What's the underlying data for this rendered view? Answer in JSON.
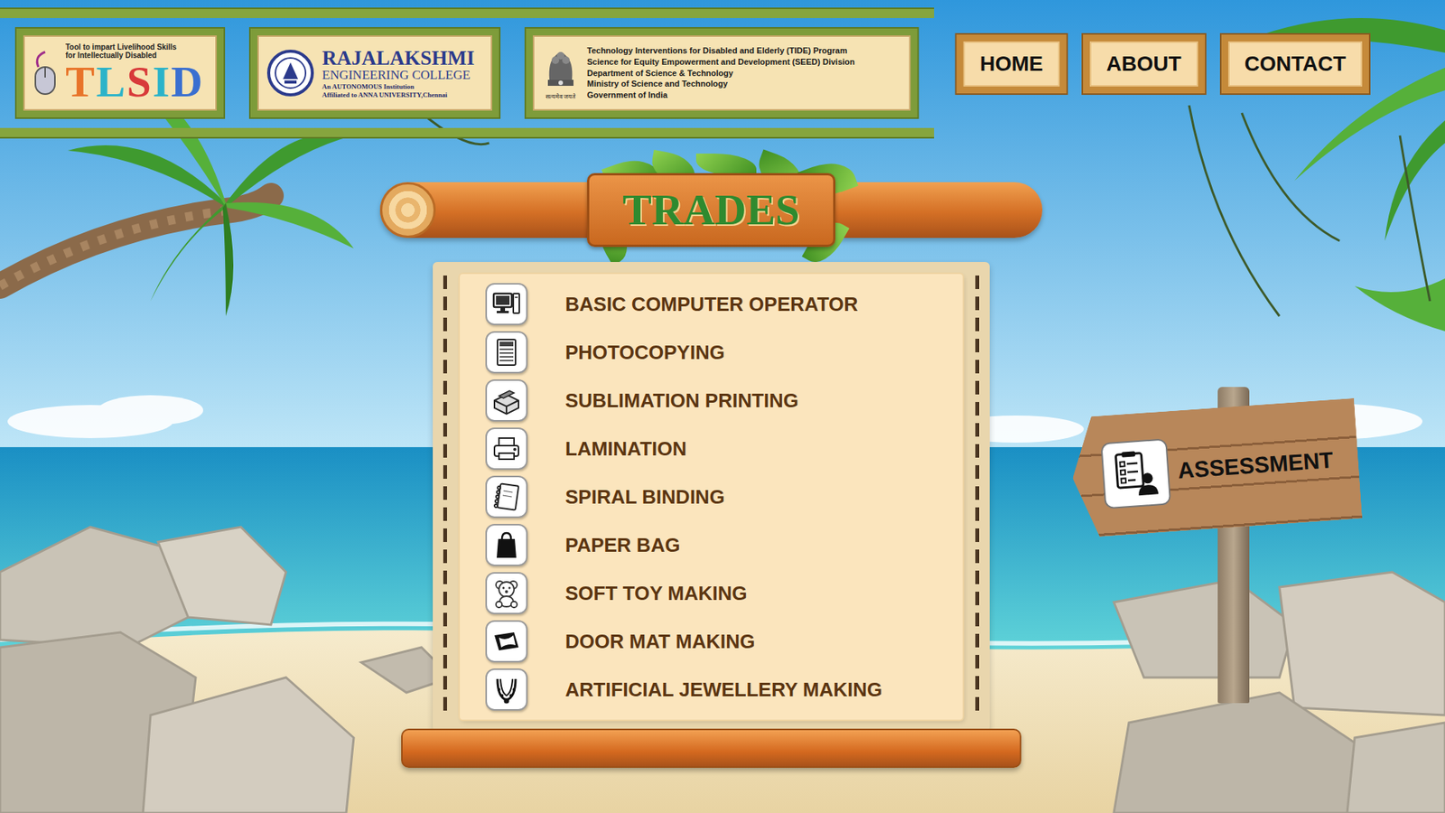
{
  "header": {
    "tlsid": {
      "tagline": [
        "Tool to impart Livelihood Skills",
        "for Intellectually Disabled"
      ],
      "title": "TLSID"
    },
    "college": {
      "name": "RAJALAKSHMI",
      "subtitle": "ENGINEERING COLLEGE",
      "notes": [
        "An AUTONOMOUS Institution",
        "Affiliated to ANNA UNIVERSITY,Chennai"
      ]
    },
    "government": {
      "motto": "सत्यमेव जयते",
      "lines": [
        "Technology Interventions for Disabled and Elderly (TIDE) Program",
        "Science for Equity Empowerment and Development (SEED) Division",
        "Department of Science & Technology",
        "Ministry of Science and Technology",
        "Government of India"
      ]
    },
    "nav": [
      {
        "label": "HOME"
      },
      {
        "label": "ABOUT"
      },
      {
        "label": "CONTACT"
      }
    ]
  },
  "trades": {
    "title": "TRADES",
    "items": [
      {
        "label": "BASIC COMPUTER OPERATOR"
      },
      {
        "label": "PHOTOCOPYING"
      },
      {
        "label": "SUBLIMATION PRINTING"
      },
      {
        "label": "LAMINATION"
      },
      {
        "label": "SPIRAL BINDING"
      },
      {
        "label": "PAPER BAG"
      },
      {
        "label": "SOFT TOY MAKING"
      },
      {
        "label": "DOOR MAT MAKING"
      },
      {
        "label": "ARTIFICIAL JEWELLERY MAKING"
      }
    ]
  },
  "assessment": {
    "label": "ASSESSMENT"
  }
}
